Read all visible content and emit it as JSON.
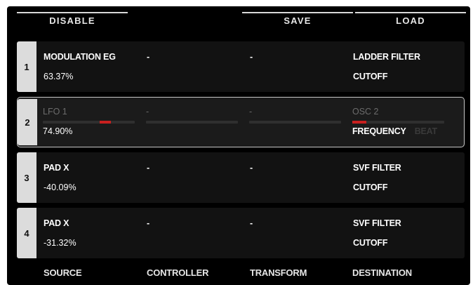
{
  "topbar": {
    "disable": "DISABLE",
    "save": "SAVE",
    "load": "LOAD"
  },
  "rows": [
    {
      "number": "1",
      "source": "MODULATION EG",
      "amount": "63.37%",
      "controller": "-",
      "transform": "-",
      "destination": "LADDER FILTER",
      "destination_param": "CUTOFF"
    },
    {
      "number": "2",
      "source": "LFO 1",
      "amount": "74.90%",
      "controller": "-",
      "transform": "-",
      "destination": "OSC 2",
      "destination_param": "FREQUENCY",
      "destination_param_next": "BEAT",
      "source_level": 0.75,
      "destination_level": 0.15,
      "accent_color": "#c8201f"
    },
    {
      "number": "3",
      "source": "PAD X",
      "amount": "-40.09%",
      "controller": "-",
      "transform": "-",
      "destination": "SVF FILTER",
      "destination_param": "CUTOFF"
    },
    {
      "number": "4",
      "source": "PAD X",
      "amount": "-31.32%",
      "controller": "-",
      "transform": "-",
      "destination": "SVF FILTER",
      "destination_param": "CUTOFF"
    }
  ],
  "footer": {
    "source": "SOURCE",
    "controller": "CONTROLLER",
    "transform": "TRANSFORM",
    "destination": "DESTINATION"
  }
}
